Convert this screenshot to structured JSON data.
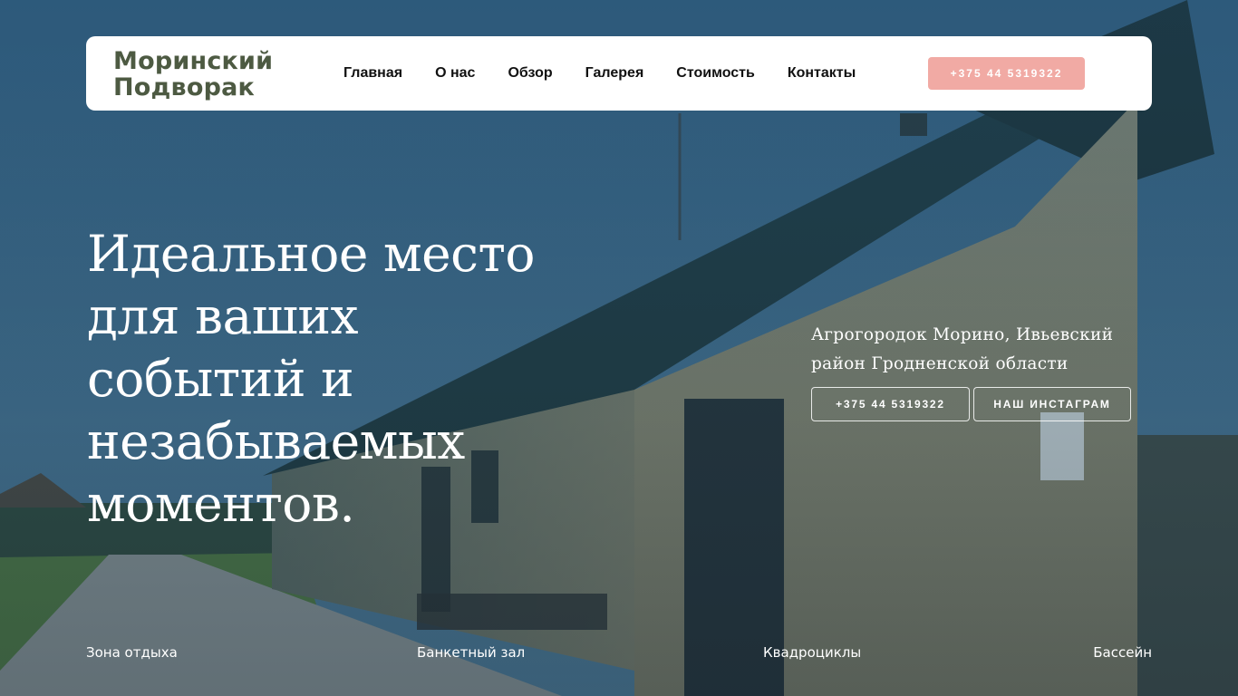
{
  "brand": {
    "logo_line1": "Моринский",
    "logo_line2": "Подворак",
    "color": "#4d5a42"
  },
  "nav": {
    "items": [
      {
        "label": "Главная"
      },
      {
        "label": "О нас"
      },
      {
        "label": "Обзор"
      },
      {
        "label": "Галерея"
      },
      {
        "label": "Стоимость"
      },
      {
        "label": "Контакты"
      }
    ],
    "phone_button": "+375 44 5319322",
    "phone_button_color": "#f1aaa4"
  },
  "hero": {
    "headline_lines": [
      "Идеальное место",
      "для ваших",
      "событий и",
      "незабываемых",
      "моментов."
    ],
    "address_line1": "Агрогородок Морино, Ивьевский",
    "address_line2": "район Гродненской области",
    "phone_button": "+375 44 5319322",
    "instagram_button": "НАШ ИНСТАГРАМ"
  },
  "features": [
    {
      "label": "Зона отдыха"
    },
    {
      "label": "Банкетный зал"
    },
    {
      "label": "Квадроциклы"
    },
    {
      "label": "Бассейн"
    }
  ]
}
